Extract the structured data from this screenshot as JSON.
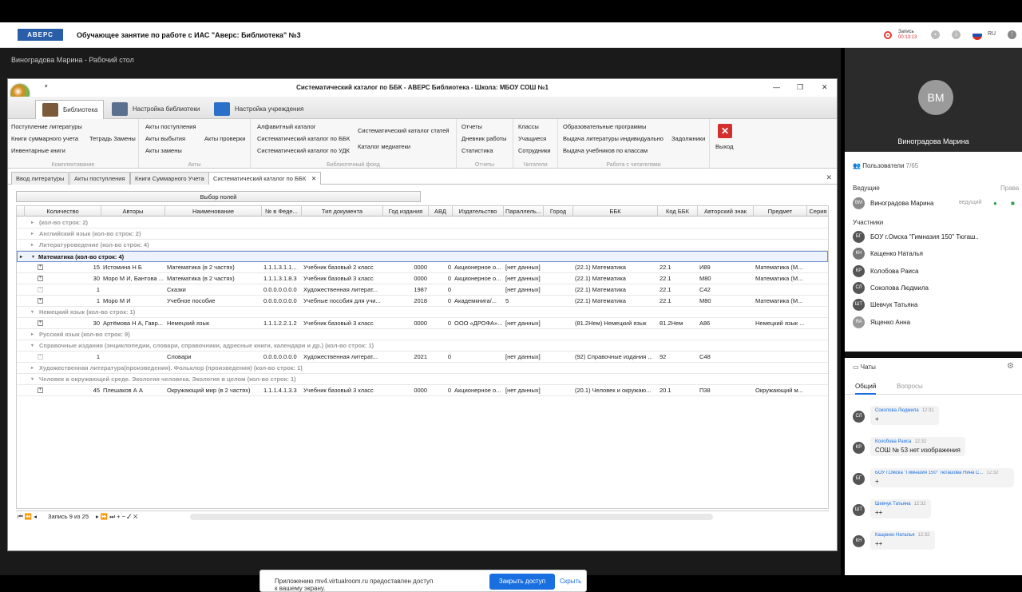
{
  "meeting": {
    "logo": "АВЕРС",
    "title": "Обучающее занятие по работе с ИАС \"Аверс: Библиотека\" №3",
    "rec_label": "Запись",
    "rec_time": "00:13:13",
    "lang": "RU"
  },
  "desktop": {
    "title": "Виноградова Марина - Рабочий стол"
  },
  "window": {
    "title": "Систематический каталог по ББК - АВЕРС Библиотека - Школа: МБОУ СОШ №1"
  },
  "ribbon_tabs": [
    "Библиотека",
    "Настройка библиотеки",
    "Настройка учреждения"
  ],
  "ribbon": {
    "g1": {
      "items": [
        "Поступление литературы",
        "Книги суммарного учета",
        "Тетрадь Замены",
        "Инвентарные книги"
      ],
      "caption": "Комплектование"
    },
    "g2": {
      "items": [
        "Акты поступления",
        "Акты выбытия",
        "Акты проверки",
        "Акты замены"
      ],
      "caption": "Акты"
    },
    "g3": {
      "items": [
        "Алфавитный каталог",
        "Систематический каталог по ББК",
        "Систематический каталог по УДК",
        "Систематический каталог статей",
        "Каталог медиатеки"
      ],
      "caption": "Библиотечный фонд"
    },
    "g4": {
      "items": [
        "Отчеты",
        "Дневник работы",
        "Статистика"
      ],
      "caption": "Отчеты"
    },
    "g5": {
      "items": [
        "Классы",
        "Учащиеся",
        "Сотрудники"
      ],
      "caption": "Читатели"
    },
    "g6": {
      "items": [
        "Образовательные программы",
        "Выдача литературы индивидуально",
        "Задолжники",
        "Выдача учебников по классам"
      ],
      "caption": "Работа с читателями"
    },
    "exit": "Выход"
  },
  "doc_tabs": [
    "Ввод литературы",
    "Акты поступления",
    "Книги Суммарного Учета",
    "Систематический каталог по ББК"
  ],
  "fields_button": "Выбор полей",
  "columns": [
    "Количество",
    "Авторы",
    "Наименование",
    "№ в Феде...",
    "Тип документа",
    "Год издания",
    "АВД",
    "Издательство",
    "Параллель...",
    "Город",
    "ББК",
    "Код ББК",
    "Авторский знак",
    "Предмет",
    "Серия"
  ],
  "groups": {
    "g0": "(кол-во строк: 2)",
    "g1": "Английский язык (кол-во строк: 2)",
    "g2": "Литературоведение (кол-во строк: 4)",
    "g3": "Математика (кол-во строк: 4)",
    "g4": "Немецкий язык (кол-во строк: 1)",
    "g5": "Русский язык (кол-во строк: 9)",
    "g6": "Справочные издания (энциклопедии, словари, справочники, адресные книги, календари и др.) (кол-во строк: 1)",
    "g7": "Художественная литература(произведения). Фольклор (произведения) (кол-во строк: 1)",
    "g8": "Человек в окружающей среде. Экология человека. Экология в целом (кол-во строк: 1)"
  },
  "rows": {
    "r1": [
      "15",
      "Истомина Н Б",
      "Математика (в 2 частях)",
      "1.1.1.3.1.1...",
      "Учебник базовый 2 класс",
      "0000",
      "0",
      "Акционерное о...",
      "[нет данных]",
      "",
      "(22.1) Математика",
      "22.1",
      "И89",
      "Математика (М..."
    ],
    "r2": [
      "30",
      "Моро М И, Бантова ...",
      "Математика (в 2 частях)",
      "1.1.1.3.1.8.3",
      "Учебник базовый 3 класс",
      "0000",
      "0",
      "Акционерное о...",
      "[нет данных]",
      "",
      "(22.1) Математика",
      "22.1",
      "М80",
      "Математика (М..."
    ],
    "r3": [
      "1",
      "",
      "Сказки",
      "0.0.0.0.0.0.0",
      "Художественная литерат...",
      "1987",
      "0",
      "",
      "[нет данных]",
      "",
      "(22.1) Математика",
      "22.1",
      "С42",
      ""
    ],
    "r4": [
      "1",
      "Моро М И",
      "Учебное пособие",
      "0.0.0.0.0.0.0",
      "Учебные пособия для учи...",
      "2018",
      "0",
      "Академкнига/...",
      "5",
      "",
      "(22.1) Математика",
      "22.1",
      "М80",
      "Математика (М..."
    ],
    "r5": [
      "30",
      "Артёмова Н А, Гавр...",
      "Немецкий язык",
      "1.1.1.2.2.1.2",
      "Учебник базовый 3 класс",
      "0000",
      "0",
      "ООО «ДРОФА»...",
      "[нет данных]",
      "",
      "(81.2Нем) Немецкий язык",
      "81.2Нем",
      "А86",
      "Немецкий язык ..."
    ],
    "r6": [
      "1",
      "",
      "Словари",
      "0.0.0.0.0.0.0",
      "Художественная литерат...",
      "2021",
      "0",
      "",
      "[нет данных]",
      "",
      "(92) Справочные издания ...",
      "92",
      "С48",
      ""
    ],
    "r7": [
      "45",
      "Плешаков А А",
      "Окружающий мир (в 2 частях)",
      "1.1.1.4.1.3.3",
      "Учебник базовый 3 класс",
      "0000",
      "0",
      "Акционерное о...",
      "[нет данных]",
      "",
      "(20.1) Человек и окружаю...",
      "20.1",
      "П38",
      "Окружающий м..."
    ]
  },
  "nav": {
    "record": "Запись 9 из 25"
  },
  "toast": {
    "message": "Приложению mv4.virtualroom.ru предоставлен доступ к вашему экрану.",
    "button": "Закрыть доступ",
    "hide": "Скрыть"
  },
  "side": {
    "avatar": "ВМ",
    "name": "Виноградова Марина",
    "users_label": "Пользователи",
    "users_count": "7/65",
    "hosts_label": "Ведущие",
    "rights_label": "Права",
    "host": {
      "initials": "ВМ",
      "name": "Виноградова Марина",
      "role": "ведущий"
    },
    "participants_label": "Участники",
    "participants": [
      {
        "initials": "БГ",
        "name": "БОУ г.Омска \"Гимназия 150\" Тюгаш..."
      },
      {
        "initials": "КН",
        "name": "Кащенко Наталья"
      },
      {
        "initials": "КР",
        "name": "Колобова Раиса"
      },
      {
        "initials": "СЛ",
        "name": "Соколова Людмила"
      },
      {
        "initials": "ШТ",
        "name": "Шевчук Татьяна"
      },
      {
        "initials": "ЯА",
        "name": "Ященко Анна"
      }
    ],
    "chats_label": "Чаты",
    "tab_general": "Общий",
    "tab_questions": "Вопросы",
    "messages": [
      {
        "initials": "СЛ",
        "author": "Соколова Людмила",
        "time": "12:31",
        "text": "+"
      },
      {
        "initials": "КР",
        "author": "Колобова Раиса",
        "time": "12:32",
        "text": "СОШ № 53 нет изображения"
      },
      {
        "initials": "БГ",
        "author": "БОУ г.Омска \"Гимназия 150\" Тюгашова Нина С...",
        "time": "12:32",
        "text": "+"
      },
      {
        "initials": "ШТ",
        "author": "Шевчук Татьяна",
        "time": "12:32",
        "text": "++"
      },
      {
        "initials": "КН",
        "author": "Кащенко Наталья",
        "time": "12:32",
        "text": "++"
      }
    ]
  }
}
